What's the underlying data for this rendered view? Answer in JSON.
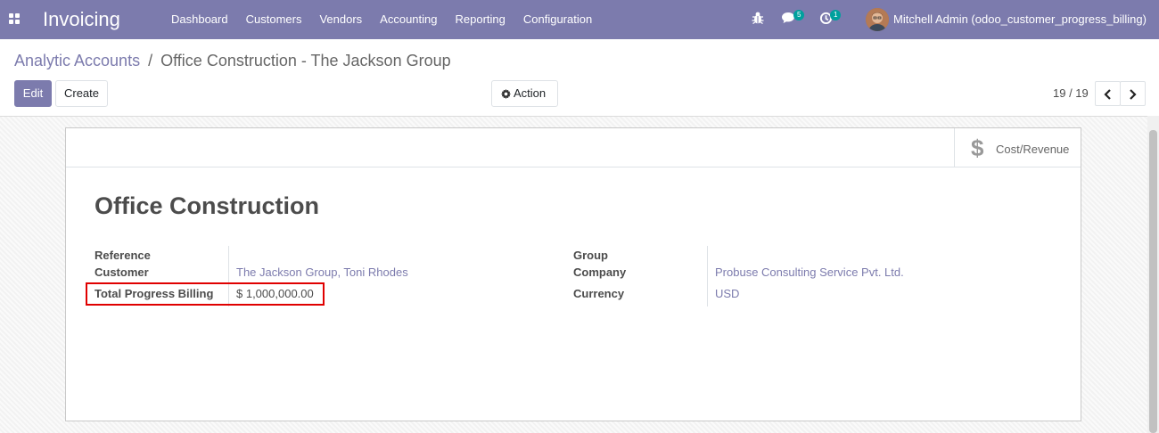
{
  "navbar": {
    "app_name": "Invoicing",
    "menu": [
      "Dashboard",
      "Customers",
      "Vendors",
      "Accounting",
      "Reporting",
      "Configuration"
    ],
    "messages_count": "5",
    "activities_count": "1",
    "user_name": "Mitchell Admin (odoo_customer_progress_billing)",
    "accent_color": "#7c7bad"
  },
  "breadcrumb": {
    "parent": "Analytic Accounts",
    "separator": "/",
    "current": "Office Construction - The Jackson Group"
  },
  "toolbar": {
    "edit_label": "Edit",
    "create_label": "Create",
    "action_label": "Action",
    "pager_text": "19 / 19"
  },
  "form": {
    "stat_button_label": "Cost/Revenue",
    "title": "Office Construction",
    "left_fields": [
      {
        "label": "Reference",
        "value": ""
      },
      {
        "label": "Customer",
        "value": "The Jackson Group, Toni Rhodes"
      },
      {
        "label": "Total Progress Billing",
        "value": "$ 1,000,000.00"
      }
    ],
    "right_fields": [
      {
        "label": "Group",
        "value": ""
      },
      {
        "label": "Company",
        "value": "Probuse Consulting Service Pvt. Ltd."
      },
      {
        "label": "Currency",
        "value": "USD"
      }
    ]
  }
}
